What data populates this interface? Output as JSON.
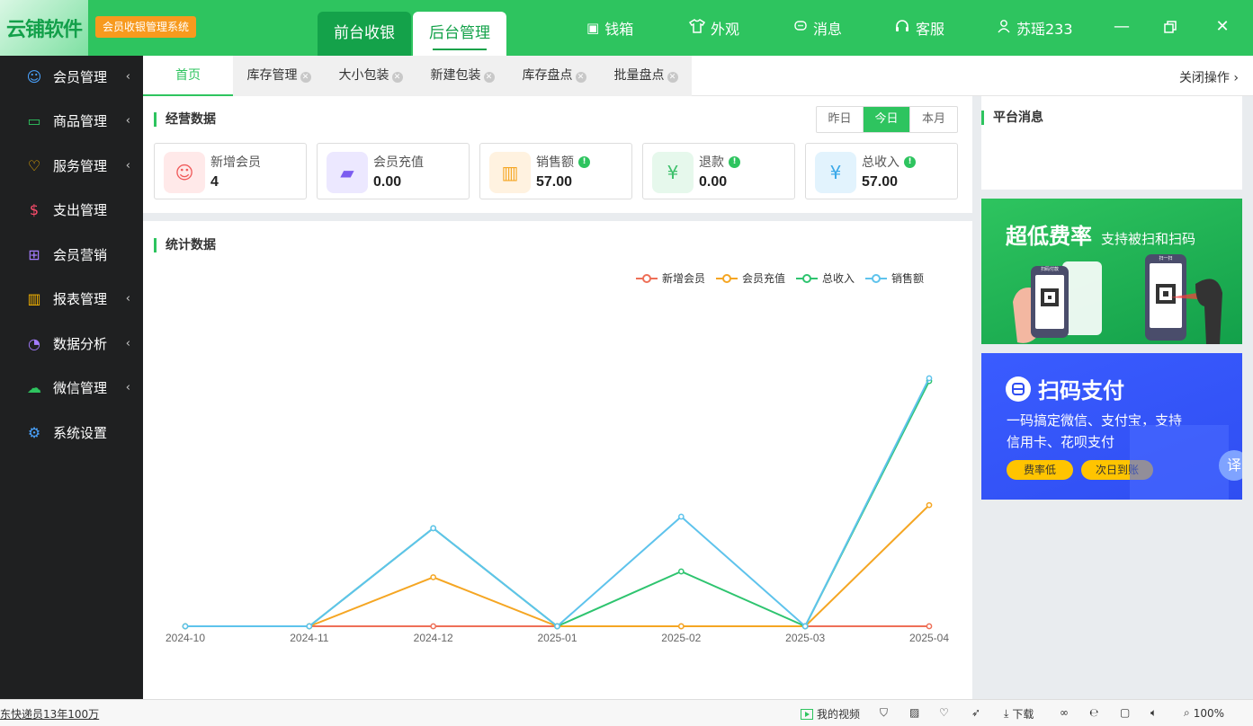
{
  "app": {
    "logo_text": "云铺软件",
    "system_badge": "会员收银管理系统"
  },
  "main_tabs": [
    {
      "label": "前台收银"
    },
    {
      "label": "后台管理"
    }
  ],
  "top_items": [
    {
      "label": "钱箱",
      "icon": "cash-box-icon"
    },
    {
      "label": "外观",
      "icon": "tshirt-icon"
    },
    {
      "label": "消息",
      "icon": "message-icon"
    },
    {
      "label": "客服",
      "icon": "headset-icon"
    },
    {
      "label": "苏瑶233",
      "icon": "user-icon"
    }
  ],
  "sidebar": {
    "items": [
      {
        "label": "会员管理",
        "icon": "member-icon",
        "color": "#4aa3ff",
        "arrow": true
      },
      {
        "label": "商品管理",
        "icon": "goods-icon",
        "color": "#2ec45f",
        "arrow": true
      },
      {
        "label": "服务管理",
        "icon": "service-icon",
        "color": "#f7b500",
        "arrow": true
      },
      {
        "label": "支出管理",
        "icon": "expense-icon",
        "color": "#ff4d6d",
        "arrow": false
      },
      {
        "label": "会员营销",
        "icon": "gift-icon",
        "color": "#a47cff",
        "arrow": false
      },
      {
        "label": "报表管理",
        "icon": "report-icon",
        "color": "#f7b500",
        "arrow": true
      },
      {
        "label": "数据分析",
        "icon": "pie-chart-icon",
        "color": "#a47cff",
        "arrow": true
      },
      {
        "label": "微信管理",
        "icon": "wechat-icon",
        "color": "#2ec45f",
        "arrow": true
      },
      {
        "label": "系统设置",
        "icon": "gear-icon",
        "color": "#4aa3ff",
        "arrow": false
      }
    ]
  },
  "sub_tabs": [
    {
      "label": "首页",
      "closable": false
    },
    {
      "label": "库存管理",
      "closable": true
    },
    {
      "label": "大小包装",
      "closable": true
    },
    {
      "label": "新建包装",
      "closable": true
    },
    {
      "label": "库存盘点",
      "closable": true
    },
    {
      "label": "批量盘点",
      "closable": true
    }
  ],
  "close_operation": "关闭操作",
  "business": {
    "title": "经营数据",
    "periods": [
      "昨日",
      "今日",
      "本月"
    ],
    "active_period": "今日",
    "cards": [
      {
        "label": "新增会员",
        "value": "4",
        "info": false,
        "icon": "new-member-icon",
        "bg": "#ffe9e9",
        "fg": "#f05a5a"
      },
      {
        "label": "会员充值",
        "value": "0.00",
        "info": false,
        "icon": "wallet-icon",
        "bg": "#ece8ff",
        "fg": "#7b5cf0"
      },
      {
        "label": "销售额",
        "value": "57.00",
        "info": true,
        "icon": "sales-icon",
        "bg": "#fff2e0",
        "fg": "#f5a623"
      },
      {
        "label": "退款",
        "value": "0.00",
        "info": true,
        "icon": "refund-icon",
        "bg": "#e6f8ec",
        "fg": "#3cc06a"
      },
      {
        "label": "总收入",
        "value": "57.00",
        "info": true,
        "icon": "income-icon",
        "bg": "#e2f3fd",
        "fg": "#3aa8e8"
      }
    ]
  },
  "stats": {
    "title": "统计数据"
  },
  "chart_data": {
    "type": "line",
    "categories": [
      "2024-10",
      "2024-11",
      "2024-12",
      "2025-01",
      "2025-02",
      "2025-03",
      "2025-04"
    ],
    "series": [
      {
        "name": "新增会员",
        "color": "#ee6f57",
        "values": [
          0,
          0,
          0,
          0,
          0,
          0,
          0
        ]
      },
      {
        "name": "会员充值",
        "color": "#f5a623",
        "values": [
          0,
          0,
          17,
          0,
          0,
          0,
          42
        ]
      },
      {
        "name": "总收入",
        "color": "#2ec46f",
        "values": [
          0,
          0,
          34,
          0,
          19,
          0,
          85
        ]
      },
      {
        "name": "销售额",
        "color": "#5ec3ec",
        "values": [
          0,
          0,
          34,
          0,
          38,
          0,
          86
        ]
      }
    ],
    "ylim": [
      0,
      100
    ],
    "legend_position": "top-right",
    "grid": false
  },
  "platform": {
    "title": "平台消息"
  },
  "banner1": {
    "title": "超低费率",
    "subtitle": "支持被扫和扫码",
    "phone_label_1": "扫码付款",
    "phone_label_2": "扫一扫"
  },
  "banner2": {
    "title": "扫码支付",
    "line1": "一码搞定微信、支付宝，支持",
    "line2": "信用卡、花呗支付",
    "tag1": "费率低",
    "tag2": "次日到账",
    "translate": "译"
  },
  "statusbar": {
    "left_text": "东快递员13年100万",
    "video": "我的视频",
    "download": "下载",
    "zoom": "100%"
  }
}
